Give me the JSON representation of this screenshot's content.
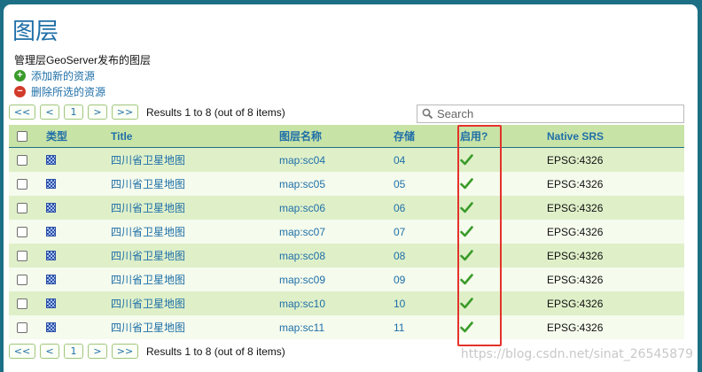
{
  "page": {
    "title": "图层",
    "subtitle": "管理层GeoServer发布的图层",
    "add_label": "添加新的资源",
    "remove_label": "删除所选的资源"
  },
  "pager": {
    "first": "<<",
    "prev": "<",
    "page": "1",
    "next": ">",
    "last": ">>",
    "info": "Results 1 to 8 (out of 8 items)"
  },
  "search": {
    "placeholder": "Search"
  },
  "table": {
    "headers": {
      "type": "类型",
      "title": "Title",
      "name": "图层名称",
      "store": "存储",
      "enabled": "启用?",
      "srs": "Native SRS"
    },
    "rows": [
      {
        "title": "四川省卫星地图",
        "name": "map:sc04",
        "store": "04",
        "enabled": true,
        "srs": "EPSG:4326"
      },
      {
        "title": "四川省卫星地图",
        "name": "map:sc05",
        "store": "05",
        "enabled": true,
        "srs": "EPSG:4326"
      },
      {
        "title": "四川省卫星地图",
        "name": "map:sc06",
        "store": "06",
        "enabled": true,
        "srs": "EPSG:4326"
      },
      {
        "title": "四川省卫星地图",
        "name": "map:sc07",
        "store": "07",
        "enabled": true,
        "srs": "EPSG:4326"
      },
      {
        "title": "四川省卫星地图",
        "name": "map:sc08",
        "store": "08",
        "enabled": true,
        "srs": "EPSG:4326"
      },
      {
        "title": "四川省卫星地图",
        "name": "map:sc09",
        "store": "09",
        "enabled": true,
        "srs": "EPSG:4326"
      },
      {
        "title": "四川省卫星地图",
        "name": "map:sc10",
        "store": "10",
        "enabled": true,
        "srs": "EPSG:4326"
      },
      {
        "title": "四川省卫星地图",
        "name": "map:sc11",
        "store": "11",
        "enabled": true,
        "srs": "EPSG:4326"
      }
    ]
  },
  "watermark": "https://blog.csdn.net/sinat_26545879",
  "colors": {
    "header_bg": "#c8e3a6",
    "row_odd": "#dff0c9",
    "row_even": "#f5fbed",
    "link": "#1f6fa8",
    "highlight": "#e4322b",
    "check": "#3a9b2a"
  },
  "icons": {
    "add": "plus-circle-icon",
    "remove": "minus-circle-icon",
    "search": "search-icon",
    "layer": "layer-grid-icon",
    "enabled": "checkmark-icon"
  }
}
